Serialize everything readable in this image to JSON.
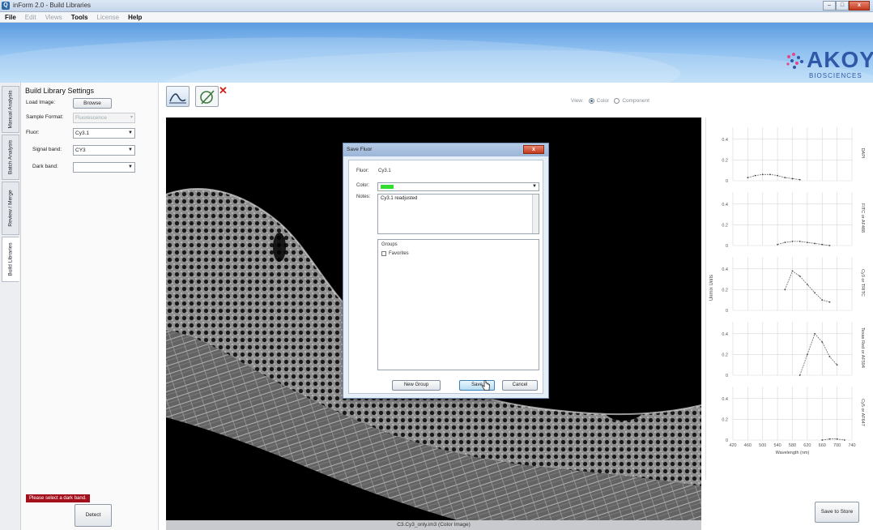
{
  "window": {
    "title": "inForm 2.0 - Build Libraries",
    "app_icon": "Q",
    "controls": [
      "minimize",
      "maximize",
      "close"
    ],
    "close_glyph": "x"
  },
  "menu": [
    {
      "label": "File",
      "enabled": true
    },
    {
      "label": "Edit",
      "enabled": false
    },
    {
      "label": "Views",
      "enabled": false
    },
    {
      "label": "Tools",
      "enabled": true
    },
    {
      "label": "License",
      "enabled": false
    },
    {
      "label": "Help",
      "enabled": true
    }
  ],
  "banner": {
    "logo_text": "AKOYA",
    "logo_sub": "BIOSCIENCES"
  },
  "vertical_tabs": [
    {
      "label": "Manual Analysis",
      "active": false
    },
    {
      "label": "Batch Analysis",
      "active": false
    },
    {
      "label": "Review / Merge",
      "active": false
    },
    {
      "label": "Build Libraries",
      "active": true
    }
  ],
  "left_panel": {
    "heading": "Build Library Settings",
    "load_image_label": "Load Image:",
    "browse_label": "Browse",
    "sample_format_label": "Sample Format:",
    "sample_format_value": "Fluorescence",
    "fluor_label": "Fluor:",
    "fluor_value": "Cy3.1",
    "signal_band_label": "Signal band:",
    "signal_band_value": "CY3",
    "dark_band_label": "Dark band:",
    "dark_band_value": "",
    "error_message": "Please select a dark band.",
    "detect_label": "Detect"
  },
  "toolbar": {
    "view_label": "View:",
    "view_options": [
      {
        "label": "Color",
        "selected": true
      },
      {
        "label": "Component",
        "selected": false
      }
    ]
  },
  "image": {
    "caption": "C3.Cy3_only.im3 (Color Image)"
  },
  "save_library_label": "Save to Store",
  "dialog": {
    "title": "Save Fluor",
    "fluor_label": "Fluor:",
    "fluor_value": "Cy3.1",
    "color_label": "Color:",
    "color_value": "#33dd33",
    "notes_label": "Notes:",
    "notes_value": "Cy3.1 readjusted",
    "groups_label": "Groups",
    "groups": [
      {
        "label": "Favorites",
        "checked": false
      }
    ],
    "new_group_label": "New Group",
    "save_label": "Save",
    "cancel_label": "Cancel"
  },
  "chart_data": {
    "type": "line",
    "xlabel": "Wavelength (nm)",
    "ylabel": "Unmix Units",
    "x_ticks": [
      420,
      460,
      500,
      540,
      580,
      620,
      660,
      700,
      740
    ],
    "xlim": [
      420,
      740
    ],
    "ylim": [
      0,
      0.5
    ],
    "y_ticks": [
      0,
      0.2,
      0.4
    ],
    "grid": true,
    "panels": [
      {
        "name": "DAPI",
        "x": [
          460,
          480,
          500,
          520,
          540,
          560,
          580,
          600
        ],
        "y": [
          0.03,
          0.05,
          0.06,
          0.06,
          0.05,
          0.03,
          0.02,
          0.01
        ]
      },
      {
        "name": "FITC or AF488",
        "x": [
          540,
          560,
          580,
          600,
          620,
          640,
          660,
          680
        ],
        "y": [
          0.01,
          0.03,
          0.04,
          0.04,
          0.03,
          0.02,
          0.01,
          0.0
        ]
      },
      {
        "name": "Cy3 or TRITC",
        "x": [
          560,
          580,
          600,
          620,
          640,
          660,
          680
        ],
        "y": [
          0.2,
          0.38,
          0.33,
          0.25,
          0.17,
          0.1,
          0.08
        ]
      },
      {
        "name": "Texas Red or AF594",
        "x": [
          600,
          620,
          640,
          660,
          680,
          700
        ],
        "y": [
          0.0,
          0.2,
          0.4,
          0.32,
          0.18,
          0.1
        ]
      },
      {
        "name": "Cy5 or AF647",
        "x": [
          660,
          680,
          700,
          720
        ],
        "y": [
          0.0,
          0.01,
          0.01,
          0.0
        ]
      }
    ]
  },
  "colors": {
    "accent": "#2f58a8",
    "error": "#a3101c",
    "fluor_swatch": "#33dd33",
    "close_button": "#c43a1e"
  }
}
